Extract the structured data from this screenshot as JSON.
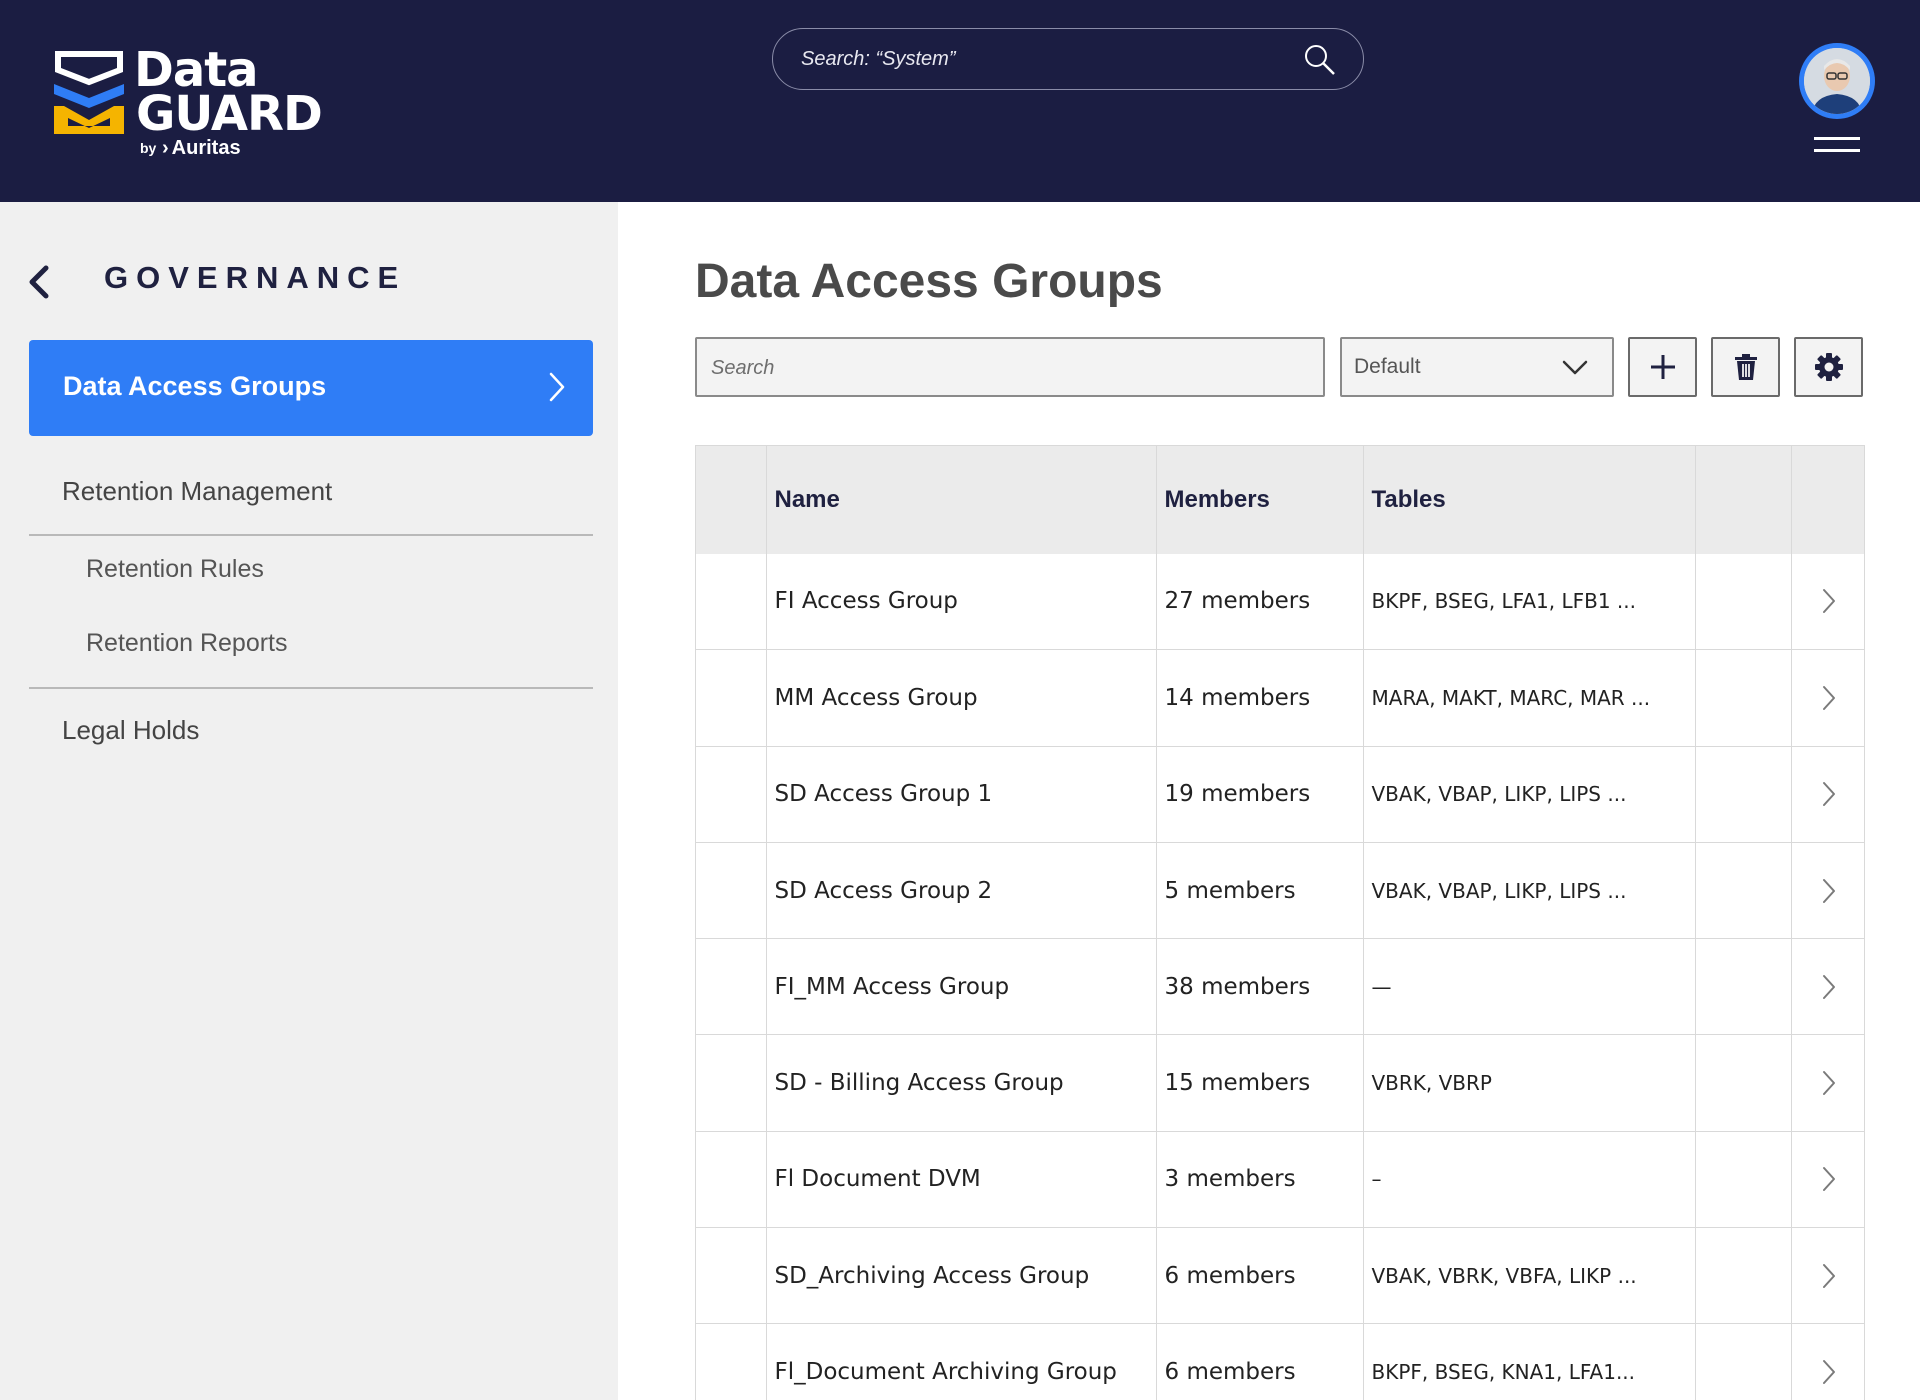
{
  "header": {
    "logo": {
      "line1": "Data",
      "line2": "GUARD",
      "by": "by",
      "brand": "Auritas",
      "brand_mark": "›"
    },
    "search": {
      "placeholder": "Search: “System”",
      "icon": "search-icon"
    },
    "avatar": "user-avatar",
    "menu_icon": "hamburger-menu-icon"
  },
  "sidebar": {
    "section_title": "GOVERNANCE",
    "active_item": "Data Access Groups",
    "items": [
      {
        "label": "Retention Management"
      },
      {
        "label": "Retention Rules"
      },
      {
        "label": "Retention Reports"
      },
      {
        "label": "Legal Holds"
      }
    ]
  },
  "main": {
    "title": "Data Access Groups",
    "search_placeholder": "Search",
    "select_value": "Default",
    "buttons": {
      "add": "plus-icon",
      "delete": "trash-icon",
      "settings": "gear-icon"
    },
    "table": {
      "columns": [
        "",
        "Name",
        "Members",
        "Tables",
        "",
        ""
      ],
      "rows": [
        {
          "name": "FI Access Group",
          "members": "27 members",
          "tables": "BKPF, BSEG, LFA1, LFB1 ..."
        },
        {
          "name": "MM Access Group",
          "members": "14 members",
          "tables": "MARA, MAKT, MARC, MAR ..."
        },
        {
          "name": "SD Access Group 1",
          "members": "19 members",
          "tables": "VBAK, VBAP, LIKP, LIPS ..."
        },
        {
          "name": "SD Access Group 2",
          "members": "5 members",
          "tables": "VBAK, VBAP, LIKP, LIPS ..."
        },
        {
          "name": "FI_MM Access Group",
          "members": "38 members",
          "tables": "—"
        },
        {
          "name": "SD - Billing Access Group",
          "members": "15 members",
          "tables": "VBRK, VBRP"
        },
        {
          "name": "Fl Document DVM",
          "members": "3 members",
          "tables": "–"
        },
        {
          "name": "SD_Archiving Access Group",
          "members": "6 members",
          "tables": "VBAK, VBRK, VBFA, LIKP ..."
        },
        {
          "name": "Fl_Document Archiving Group",
          "members": "6 members",
          "tables": "BKPF, BSEG, KNA1, LFA1..."
        }
      ]
    }
  },
  "colors": {
    "header_bg": "#1b1d42",
    "accent": "#2f7df6",
    "logo_blue": "#2f7df6",
    "logo_yellow": "#f5b400",
    "sidebar_bg": "#f0f0f0"
  }
}
